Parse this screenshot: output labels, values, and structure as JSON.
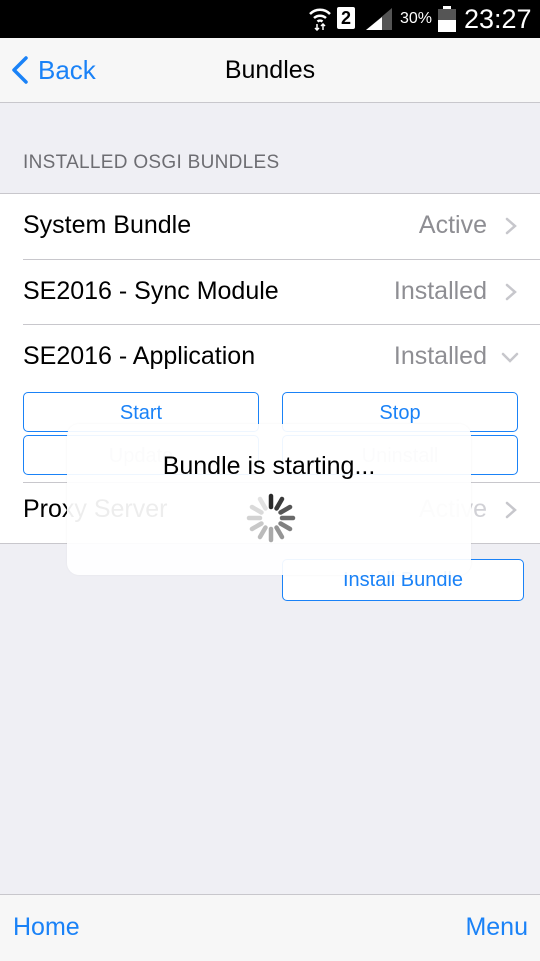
{
  "status_bar": {
    "sim_slot": "2",
    "battery_percent": "30%",
    "time": "23:27"
  },
  "nav": {
    "back_label": "Back",
    "title": "Bundles"
  },
  "section_header": "INSTALLED OSGI BUNDLES",
  "bundles": [
    {
      "name": "System Bundle",
      "status": "Active",
      "chevron": "chevron-right-icon"
    },
    {
      "name": "SE2016 - Sync Module",
      "status": "Installed",
      "chevron": "chevron-right-icon"
    },
    {
      "name": "SE2016 - Application",
      "status": "Installed",
      "chevron": "chevron-down-icon"
    },
    {
      "name": "Proxy Server",
      "status": "Active",
      "chevron": "chevron-right-icon"
    }
  ],
  "bundle_actions": {
    "start": "Start",
    "stop": "Stop",
    "update": "Update",
    "uninstall": "Uninstall"
  },
  "install_button": "Install Bundle",
  "loading_overlay": {
    "message": "Bundle is starting..."
  },
  "bottom_bar": {
    "home": "Home",
    "menu": "Menu"
  },
  "colors": {
    "accent": "#1a82f7",
    "background": "#efeff4",
    "secondary_text": "#8e8e93"
  }
}
